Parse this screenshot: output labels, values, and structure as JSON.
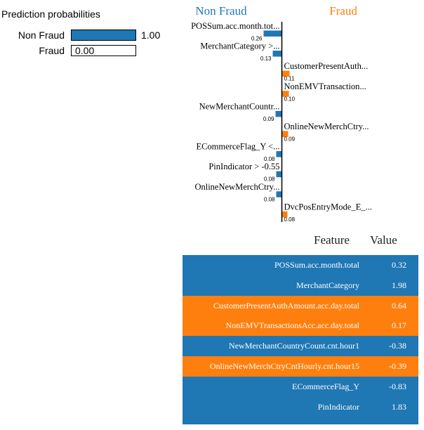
{
  "probabilities": {
    "title": "Prediction probabilities",
    "items": [
      {
        "label": "Non Fraud",
        "value": 1.0,
        "value_text": "1.00",
        "color": "#1f77b4"
      },
      {
        "label": "Fraud",
        "value": 0.0,
        "value_text": "0.00",
        "color": "#ff7f0e"
      }
    ]
  },
  "chart_data": {
    "type": "bar",
    "orientation": "horizontal",
    "class_headers": {
      "negative": "Non Fraud",
      "positive": "Fraud"
    },
    "colors": {
      "negative": "#1f77b4",
      "positive": "#ff7f0e"
    },
    "features": [
      {
        "label": "POSSum.acc.month.tot...",
        "weight": -0.26,
        "weight_text": "0.26"
      },
      {
        "label": "MerchantCategory >...",
        "weight": -0.13,
        "weight_text": "0.13"
      },
      {
        "label": "CustomerPresentAuth...",
        "weight": 0.11,
        "weight_text": "0.11"
      },
      {
        "label": "NonEMVTransaction...",
        "weight": 0.1,
        "weight_text": "0.10"
      },
      {
        "label": "NewMerchantCountr...",
        "weight": -0.09,
        "weight_text": "0.09"
      },
      {
        "label": "OnlineNewMerchCtry...",
        "weight": 0.09,
        "weight_text": "0.09"
      },
      {
        "label": "ECommerceFlag_Y <...",
        "weight": -0.08,
        "weight_text": "0.08"
      },
      {
        "label": "PinIndicator > -0.55",
        "weight": -0.08,
        "weight_text": "0.08"
      },
      {
        "label": "OnlineNewMerchCtry...",
        "weight": -0.08,
        "weight_text": "0.08"
      },
      {
        "label": "DvcPosEntryMode_E_...",
        "weight": 0.08,
        "weight_text": "0.08"
      }
    ]
  },
  "table": {
    "header_feature": "Feature",
    "header_value": "Value",
    "rows": [
      {
        "feature": "POSSum.acc.month.total",
        "value": "0.32",
        "color": "#1f77b4"
      },
      {
        "feature": "MerchantCategory",
        "value": "1.98",
        "color": "#1f77b4"
      },
      {
        "feature": "CustomerPresentAuthAmount.acc.day.total",
        "value": "0.64",
        "color": "#ff7f0e"
      },
      {
        "feature": "NonEMVTransactionsAcc.acc.day.total",
        "value": "0.17",
        "color": "#ff7f0e"
      },
      {
        "feature": "NewMerchantCountryCount.cnt.hour1",
        "value": "-0.38",
        "color": "#1f77b4"
      },
      {
        "feature": "OnlineNewMerchCtryCntHourly.cnt.hour15",
        "value": "-0.39",
        "color": "#ff7f0e"
      },
      {
        "feature": "ECommerceFlag_Y",
        "value": "-0.83",
        "color": "#1f77b4"
      },
      {
        "feature": "PinIndicator",
        "value": "1.83",
        "color": "#1f77b4"
      }
    ]
  }
}
